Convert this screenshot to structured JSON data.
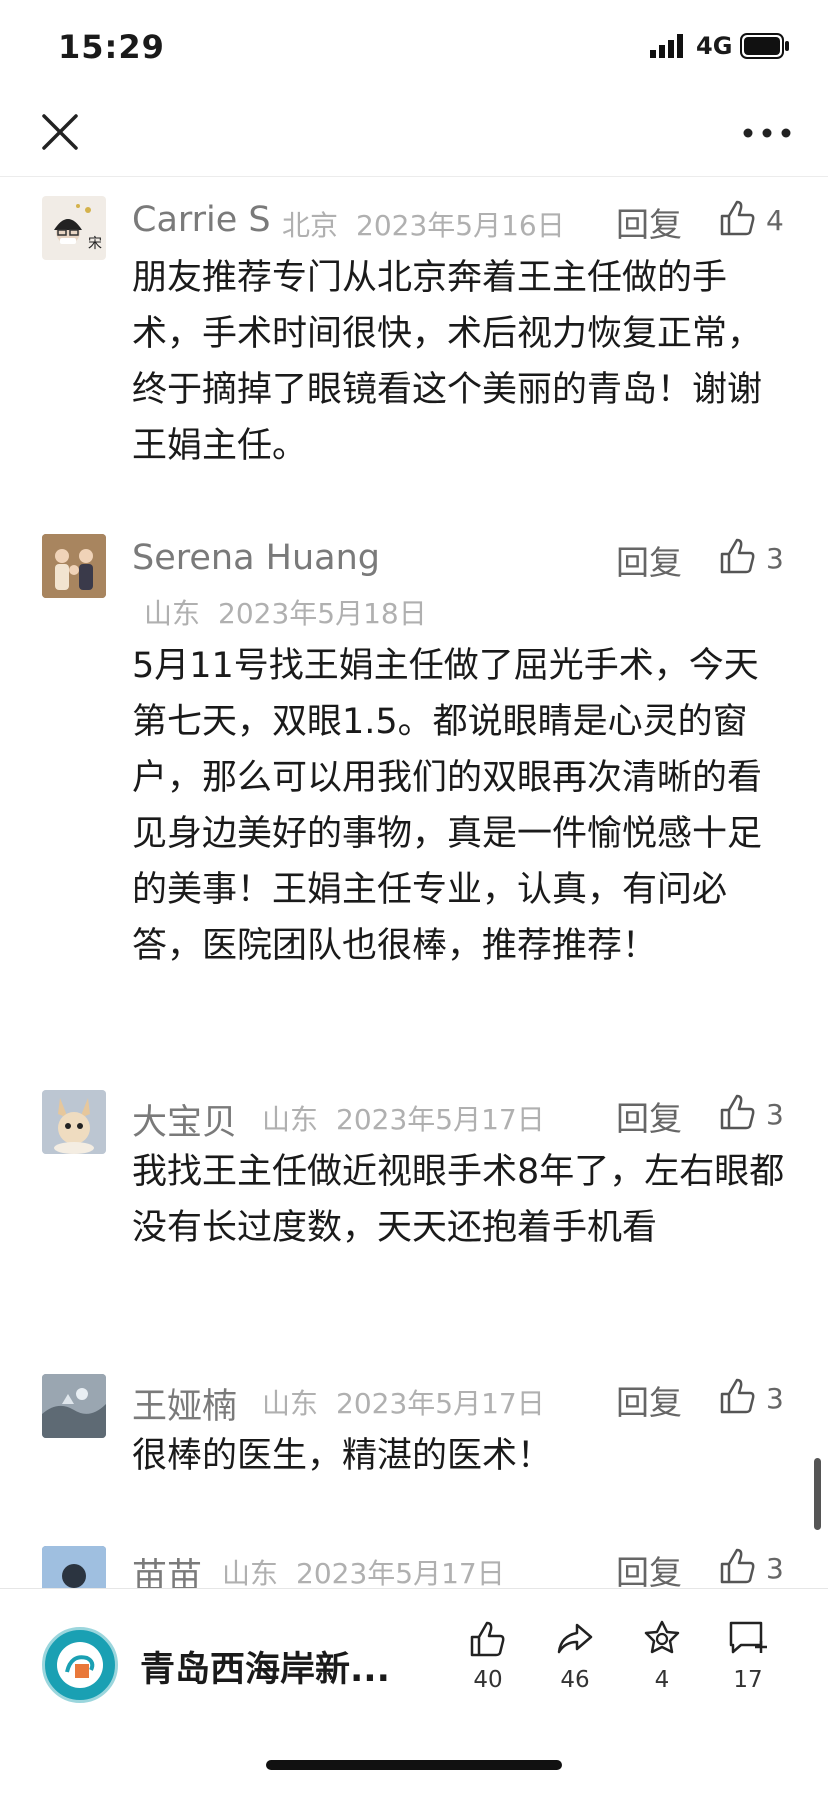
{
  "status": {
    "time": "15:29",
    "network": "4G"
  },
  "nav": {
    "close_icon": "close-icon",
    "more_icon": "more-icon"
  },
  "comments": [
    {
      "name": "Carrie S",
      "location": "北京",
      "date": "2023年5月16日",
      "reply": "回复",
      "likes": "4",
      "text": "朋友推荐专门从北京奔着王主任做的手术，手术时间很快，术后视力恢复正常，终于摘掉了眼镜看这个美丽的青岛！谢谢王娟主任。"
    },
    {
      "name": "Serena Huang",
      "location": "山东",
      "date": "2023年5月18日",
      "reply": "回复",
      "likes": "3",
      "text": "5月11号找王娟主任做了屈光手术，今天第七天，双眼1.5。都说眼睛是心灵的窗户，那么可以用我们的双眼再次清晰的看见身边美好的事物，真是一件愉悦感十足的美事！王娟主任专业，认真，有问必答，医院团队也很棒，推荐推荐！"
    },
    {
      "name": "大宝贝",
      "location": "山东",
      "date": "2023年5月17日",
      "reply": "回复",
      "likes": "3",
      "text": "我找王主任做近视眼手术8年了，左右眼都没有长过度数，天天还抱着手机看"
    },
    {
      "name": "王娅楠",
      "location": "山东",
      "date": "2023年5月17日",
      "reply": "回复",
      "likes": "3",
      "text": "很棒的医生，精湛的医术！"
    },
    {
      "name": "苗苗",
      "location": "山东",
      "date": "2023年5月17日",
      "reply": "回复",
      "likes": "3",
      "text": ""
    }
  ],
  "bottom": {
    "account_name": "青岛西海岸新...",
    "like_count": "40",
    "share_count": "46",
    "star_count": "4",
    "comment_count": "17"
  }
}
